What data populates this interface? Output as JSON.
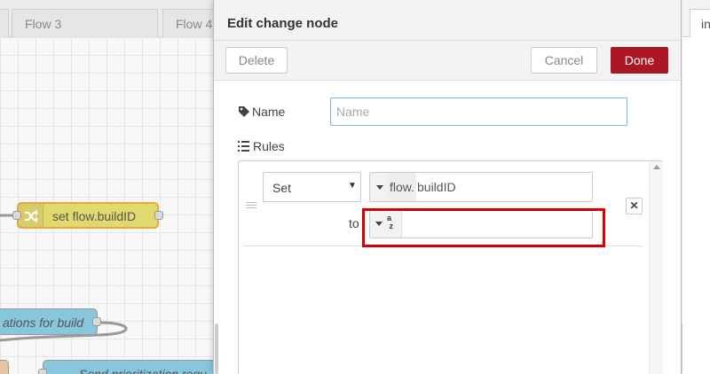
{
  "workspace": {
    "tabs": [
      {
        "label": ""
      },
      {
        "label": "Flow 3"
      },
      {
        "label": "Flow 4"
      }
    ],
    "nodes": {
      "change_node": {
        "label": "set flow.buildID",
        "color": "#e2d96e",
        "icon": "shuffle-icon"
      },
      "link_node": {
        "label": "ations for build",
        "color": "#87c6dd"
      },
      "bottom_node": {
        "label": "Send prioritization requ",
        "color": "#87c6dd"
      }
    }
  },
  "tray": {
    "title": "Edit change node",
    "delete_label": "Delete",
    "cancel_label": "Cancel",
    "done_label": "Done",
    "name_label": "Name",
    "name_value": "",
    "name_placeholder": "Name",
    "rules_label": "Rules",
    "rule": {
      "action": "Set",
      "property_prefix": "flow.",
      "property_value": "buildID",
      "to_label": "to",
      "to_type_icon": "az",
      "to_value": ""
    }
  },
  "right_sidebar": {
    "tab_label": "in"
  },
  "colors": {
    "done_button": "#ad1625",
    "highlight": "#d40000"
  }
}
